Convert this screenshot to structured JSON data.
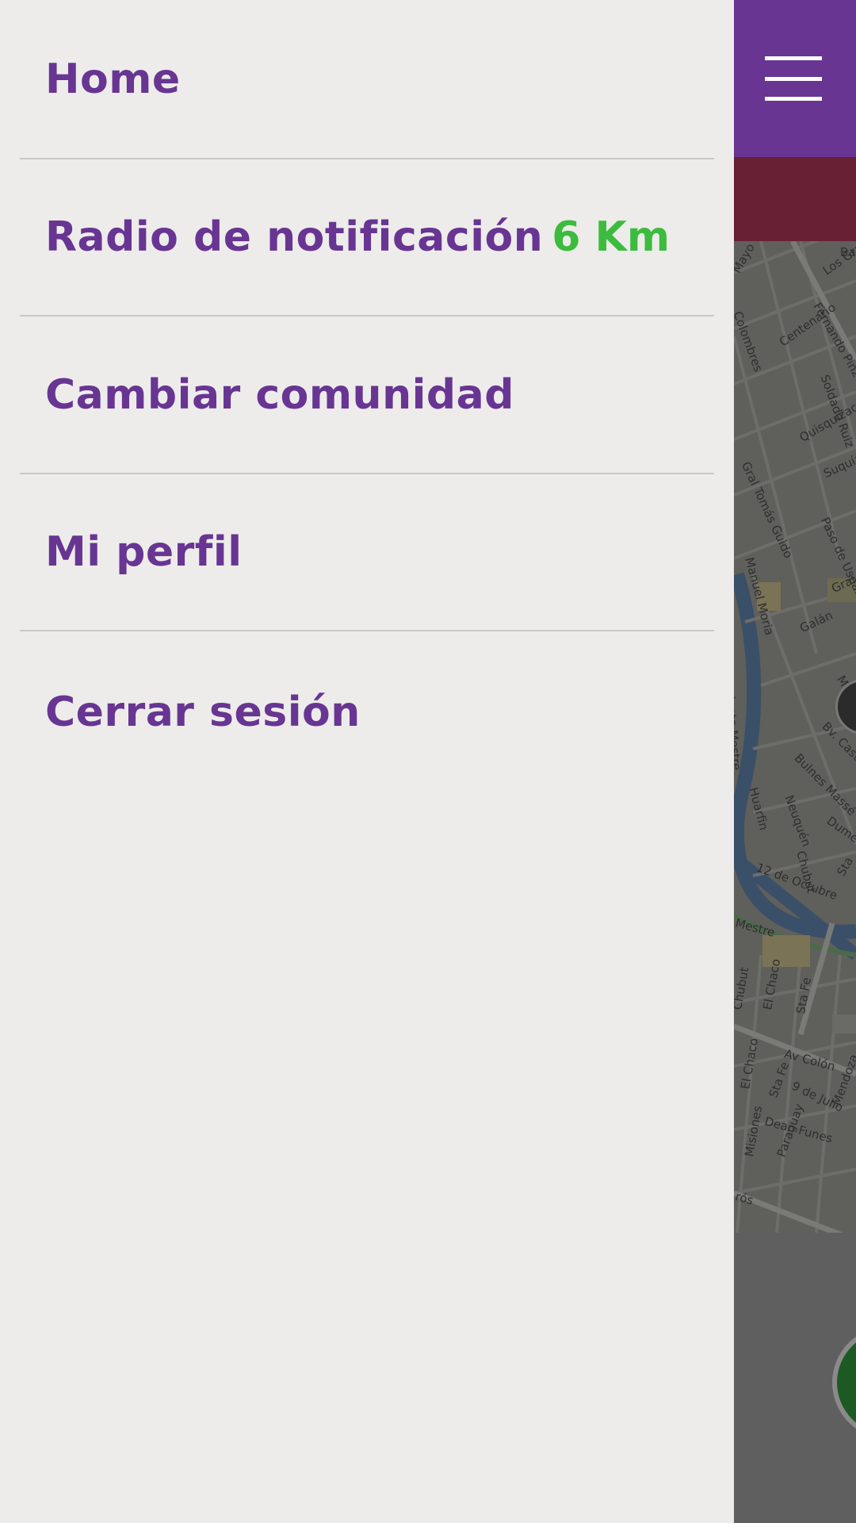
{
  "drawer": {
    "items": [
      {
        "label": "Home"
      },
      {
        "label": "Radio de notificación",
        "value": "6 Km"
      },
      {
        "label": "Cambiar comunidad"
      },
      {
        "label": "Mi perfil"
      },
      {
        "label": "Cerrar sesión"
      }
    ]
  },
  "map": {
    "labels": [
      "Mayo",
      "Colombres",
      "Centenario",
      "Fernando Pinz",
      "Soldado Ruiz",
      "Los Granad",
      "Bar",
      "Quisquizacate",
      "Gral Tomás Guido",
      "Suquía",
      "Paso de Uspall",
      "Manuel Moria",
      "Galán",
      "Gral",
      "Mar",
      "Bv. Cast",
      "ndente Mestre",
      "Bulnes Massé",
      "Huarfin",
      "Neuquén",
      "Dumesnil",
      "Chubut",
      "12 de Octubre",
      "Sta",
      "Mestre",
      "Chubut",
      "El Chaco",
      "Sta Fe",
      "Av Colón",
      "El Chaco",
      "Sta Fe",
      "9 de Julio",
      "Mendoza",
      "Dean Funes",
      "Misiones",
      "Paraguay",
      "rós"
    ]
  },
  "colors": {
    "brand_purple": "#683593",
    "subbar_maroon": "#682134",
    "value_green": "#3dbb3e",
    "drawer_bg": "#edecea"
  },
  "icons": {
    "menu": "hamburger-menu-icon"
  }
}
